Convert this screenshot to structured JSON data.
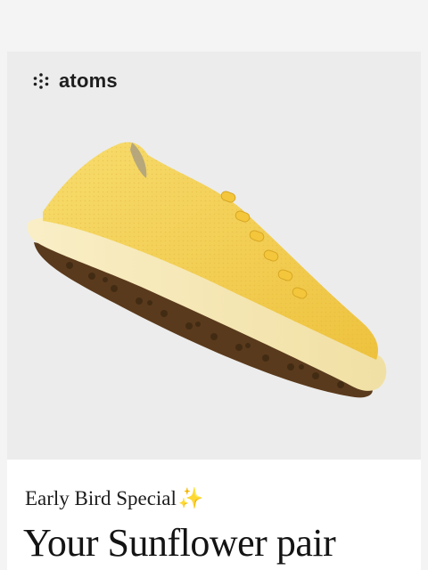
{
  "brand": {
    "name": "atoms",
    "logo_icon": "dots-cluster-icon"
  },
  "hero": {
    "product": "Sunflower sneaker",
    "colors": {
      "upper": "#f4d256",
      "sole": "#f6e8b4",
      "outsole": "#5a3a1c"
    }
  },
  "promo": {
    "eyebrow": "Early Bird Special",
    "sparkle": "✨",
    "headline": "Your Sunflower pair"
  }
}
